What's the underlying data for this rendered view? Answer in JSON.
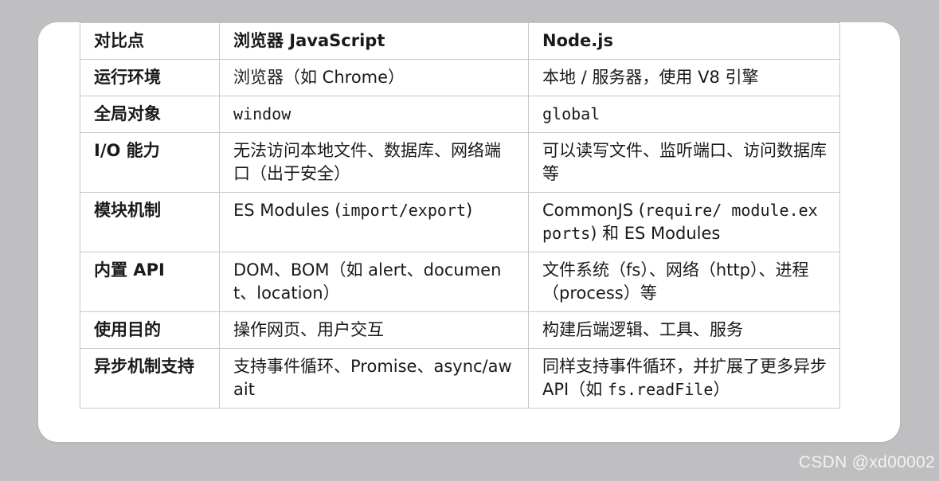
{
  "table": {
    "headers": [
      "对比点",
      "浏览器 JavaScript",
      "Node.js"
    ],
    "rows": [
      {
        "label": "运行环境",
        "browser": [
          {
            "t": "浏览器（如 Chrome）"
          }
        ],
        "node": [
          {
            "t": "本地 / 服务器，使用 V8 引擎"
          }
        ]
      },
      {
        "label": "全局对象",
        "browser": [
          {
            "t": "window",
            "code": true
          }
        ],
        "node": [
          {
            "t": "global",
            "code": true
          }
        ]
      },
      {
        "label": "I/O 能力",
        "browser": [
          {
            "t": "无法访问本地文件、数据库、网络端口（出于安全）"
          }
        ],
        "node": [
          {
            "t": "可以读写文件、监听端口、访问数据库等"
          }
        ]
      },
      {
        "label": "模块机制",
        "browser": [
          {
            "t": "ES Modules ("
          },
          {
            "t": "import/export",
            "code": true
          },
          {
            "t": ")"
          }
        ],
        "node": [
          {
            "t": "CommonJS ("
          },
          {
            "t": "require/ module.exports",
            "code": true
          },
          {
            "t": ") 和 ES Modules"
          }
        ]
      },
      {
        "label": "内置 API",
        "browser": [
          {
            "t": "DOM、BOM（如 alert、document、location）"
          }
        ],
        "node": [
          {
            "t": "文件系统（fs）、网络（http）、进程（process）等"
          }
        ]
      },
      {
        "label": "使用目的",
        "browser": [
          {
            "t": "操作网页、用户交互"
          }
        ],
        "node": [
          {
            "t": "构建后端逻辑、工具、服务"
          }
        ]
      },
      {
        "label": "异步机制支持",
        "browser": [
          {
            "t": "支持事件循环、Promise、async/await"
          }
        ],
        "node": [
          {
            "t": "同样支持事件循环，并扩展了更多异步 API（如 "
          },
          {
            "t": "fs.readFile",
            "code": true
          },
          {
            "t": "）"
          }
        ]
      }
    ]
  },
  "watermark": "CSDN @xd00002"
}
